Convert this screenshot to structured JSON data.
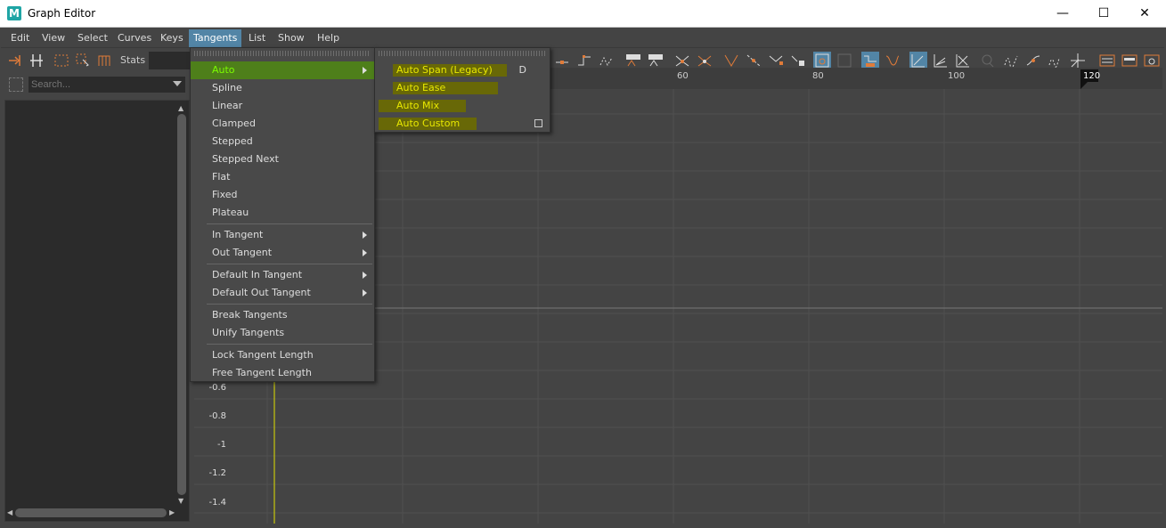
{
  "window": {
    "title": "Graph Editor",
    "logo_letter": "M",
    "minimize": "—",
    "maximize": "☐",
    "close": "✕"
  },
  "menubar": [
    {
      "label": "Edit"
    },
    {
      "label": "View"
    },
    {
      "label": "Select"
    },
    {
      "label": "Curves"
    },
    {
      "label": "Keys"
    },
    {
      "label": "Tangents"
    },
    {
      "label": "List"
    },
    {
      "label": "Show"
    },
    {
      "label": "Help"
    }
  ],
  "toolbar": {
    "stats_label": "Stats"
  },
  "outliner": {
    "search_placeholder": "Search..."
  },
  "ruler": {
    "ticks": [
      "60",
      "80",
      "100",
      "120"
    ]
  },
  "value_axis": {
    "labels": [
      "-0.6",
      "-0.8",
      "-1",
      "-1.2",
      "-1.4"
    ]
  },
  "tangents_menu": {
    "items": [
      "Auto",
      "Spline",
      "Linear",
      "Clamped",
      "Stepped",
      "Stepped Next",
      "Flat",
      "Fixed",
      "Plateau"
    ],
    "group2": [
      "In Tangent",
      "Out Tangent"
    ],
    "group3": [
      "Default In Tangent",
      "Default Out Tangent"
    ],
    "group4": [
      "Break Tangents",
      "Unify Tangents"
    ],
    "group5": [
      "Lock Tangent Length",
      "Free Tangent Length"
    ]
  },
  "auto_submenu": {
    "items": [
      {
        "label": "Auto Span (Legacy)",
        "shortcut": "D"
      },
      {
        "label": "Auto Ease"
      },
      {
        "label": "Auto Mix"
      },
      {
        "label": "Auto Custom"
      }
    ]
  },
  "colors": {
    "highlight_green": "#7cfc00",
    "menu_active": "#5285a6",
    "current_time": "#e0e000",
    "submenu_text": "#e8e800"
  }
}
